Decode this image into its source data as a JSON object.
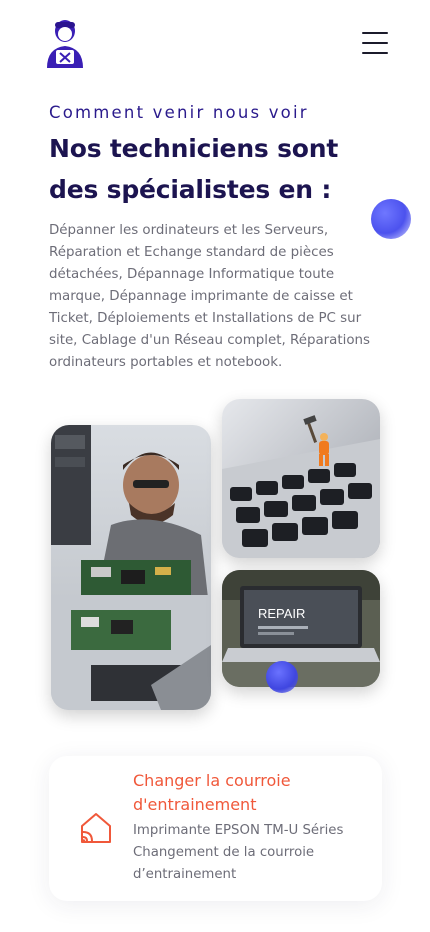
{
  "header": {
    "logo_icon": "technician-avatar-icon",
    "menu_icon": "hamburger-menu-icon"
  },
  "hero": {
    "kicker": "Comment venir nous voir",
    "title": "Nos techniciens sont des spécialistes en :",
    "description": "Dépanner les ordinateurs et les Serveurs, Réparation et Echange standard de pièces détachées, Dépannage Informatique toute marque, Dépannage imprimante de caisse et Ticket, Déploiements et Installations de PC sur site, Cablage d'un Réseau complet, Réparations ordinateurs portables et notebook."
  },
  "gallery": {
    "laptop_screen_text": "REPAIR"
  },
  "service_card": {
    "icon": "home-signal-icon",
    "title": "Changer la courroie d'entrainement",
    "text": "Imprimante EPSON TM-U Séries Changement de la courroie d’entrainement"
  },
  "colors": {
    "kicker": "#2a1a8c",
    "title": "#1c1450",
    "accent_orange": "#f0583a",
    "blob_blue": "#4c52ee"
  }
}
